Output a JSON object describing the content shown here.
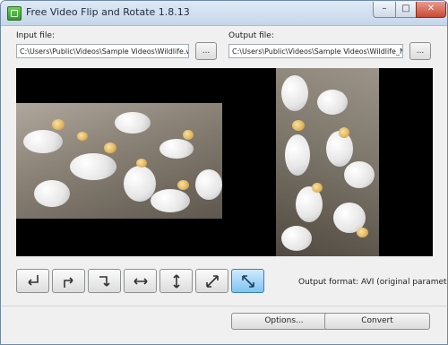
{
  "window": {
    "title": "Free Video Flip and Rotate 1.8.13",
    "controls": {
      "minimize": "–",
      "maximize": "□",
      "close": "✕"
    }
  },
  "input": {
    "label": "Input file:",
    "value": "C:\\Users\\Public\\Videos\\Sample Videos\\Wildlife.wmv",
    "browse_label": "..."
  },
  "output": {
    "label": "Output file:",
    "value": "C:\\Users\\Public\\Videos\\Sample Videos\\Wildlife_NEW...",
    "browse_label": "..."
  },
  "tools": [
    {
      "name": "rotate-left-down",
      "icon": "arrow-turn-down-left-icon",
      "active": false
    },
    {
      "name": "rotate-right",
      "icon": "arrow-turn-right-icon",
      "active": false
    },
    {
      "name": "rotate-down-right",
      "icon": "arrow-turn-down-right-icon",
      "active": false
    },
    {
      "name": "flip-horizontal",
      "icon": "arrow-left-right-icon",
      "active": false
    },
    {
      "name": "flip-vertical",
      "icon": "arrow-up-down-icon",
      "active": false
    },
    {
      "name": "transpose",
      "icon": "arrow-diagonal-up-right-icon",
      "active": false
    },
    {
      "name": "transverse",
      "icon": "arrow-diagonal-down-right-icon",
      "active": true
    }
  ],
  "output_format": "Output format: AVI (original parameters)",
  "buttons": {
    "options": "Options...",
    "convert": "Convert"
  },
  "colors": {
    "active_tool": "#7fc4f2",
    "preview_background": "#000000",
    "title_bar": "#c6d6ea"
  }
}
